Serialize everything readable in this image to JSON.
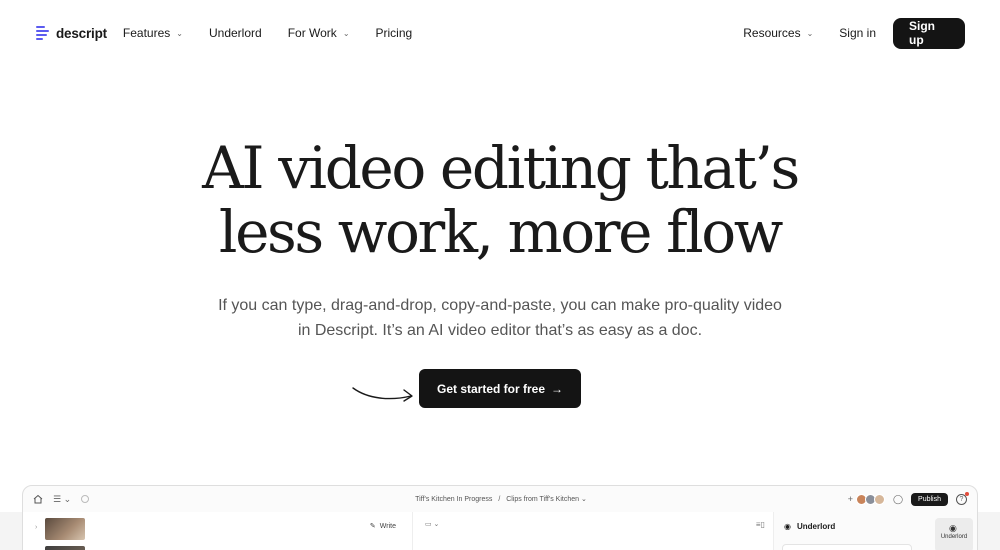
{
  "nav": {
    "brand": "descript",
    "items": [
      {
        "label": "Features",
        "has_caret": true
      },
      {
        "label": "Underlord",
        "has_caret": false
      },
      {
        "label": "For Work",
        "has_caret": true
      },
      {
        "label": "Pricing",
        "has_caret": false
      }
    ],
    "resources": "Resources",
    "sign_in": "Sign in",
    "sign_up": "Sign up"
  },
  "hero": {
    "title_line1": "AI video editing that’s",
    "title_line2": "less work, more flow",
    "subtitle_line1": "If you can type, drag-and-drop, copy-and-paste, you can make pro-quality video",
    "subtitle_line2": "in Descript. It’s an AI video editor that’s as easy as a doc.",
    "cta": "Get started for free",
    "cta_arrow": "→"
  },
  "app_preview": {
    "breadcrumb_project": "Tiff's Kitchen In Progress",
    "breadcrumb_sep": "/",
    "breadcrumb_clip": "Clips from Tiff's Kitchen",
    "publish": "Publish",
    "write": "Write",
    "underlord_title": "Underlord",
    "underlord_side": "Underlord"
  },
  "colors": {
    "accent": "#5b5bf0",
    "button_dark": "#141414",
    "text": "#1a1a1a",
    "muted": "#555555"
  }
}
